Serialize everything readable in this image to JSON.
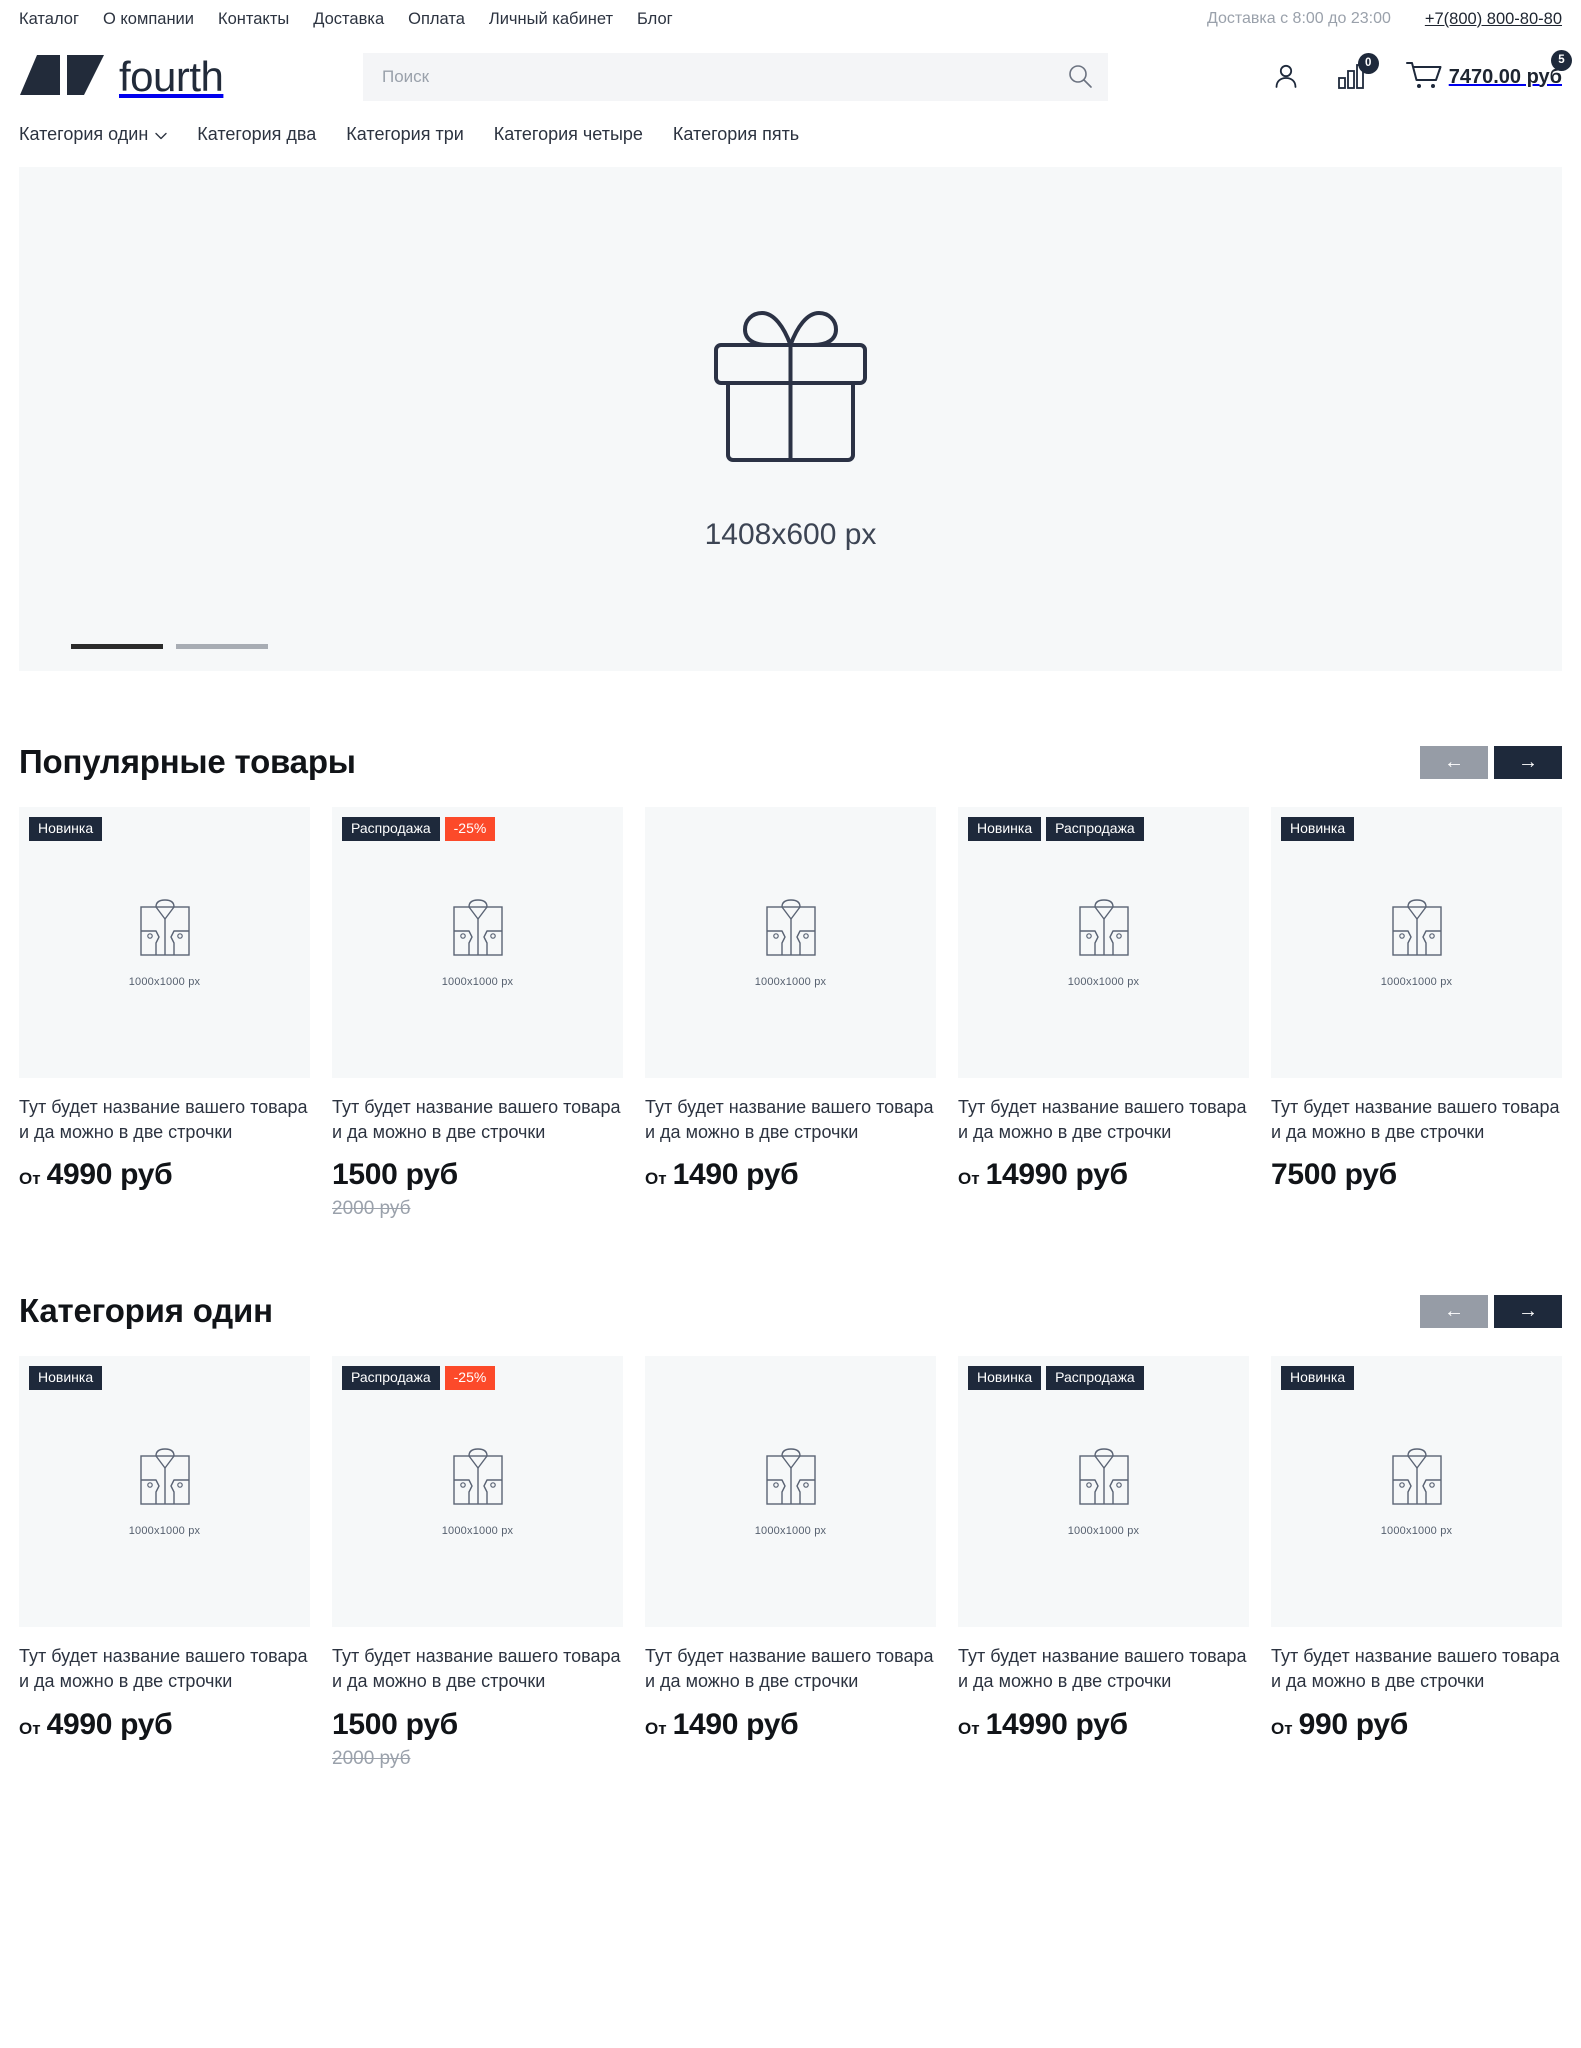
{
  "topbar": {
    "nav": [
      {
        "label": "Каталог"
      },
      {
        "label": "О компании"
      },
      {
        "label": "Контакты"
      },
      {
        "label": "Доставка"
      },
      {
        "label": "Оплата"
      },
      {
        "label": "Личный кабинет"
      },
      {
        "label": "Блог"
      }
    ],
    "delivery_hours": "Доставка с 8:00 до 23:00",
    "phone": "+7(800) 800-80-80"
  },
  "header": {
    "logo_text": "fourth",
    "search": {
      "placeholder": "Поиск",
      "value": ""
    },
    "compare_count": "0",
    "cart_count": "5",
    "cart_total": "7470.00 руб"
  },
  "catnav": [
    {
      "label": "Категория один",
      "has_chevron": true
    },
    {
      "label": "Категория два",
      "has_chevron": false
    },
    {
      "label": "Категория три",
      "has_chevron": false
    },
    {
      "label": "Категория четыре",
      "has_chevron": false
    },
    {
      "label": "Категория пять",
      "has_chevron": false
    }
  ],
  "hero": {
    "size_label": "1408x600 px",
    "slides": [
      {
        "active": true
      },
      {
        "active": false
      }
    ]
  },
  "sections": [
    {
      "title": "Популярные товары",
      "prev_label": "←",
      "next_label": "→",
      "products": [
        {
          "badges": [
            {
              "text": "Новинка",
              "kind": "new"
            }
          ],
          "media_size": "1000x1000 px",
          "title": "Тут будет название вашего товара и да можно в две строчки",
          "price_from": "От",
          "price": "4990 руб",
          "old_price": ""
        },
        {
          "badges": [
            {
              "text": "Распродажа",
              "kind": "sale"
            },
            {
              "text": "-25%",
              "kind": "discount"
            }
          ],
          "media_size": "1000x1000 px",
          "title": "Тут будет название вашего товара и да можно в две строчки",
          "price_from": "",
          "price": "1500 руб",
          "old_price": "2000 руб"
        },
        {
          "badges": [],
          "media_size": "1000x1000 px",
          "title": "Тут будет название вашего товара и да можно в две строчки",
          "price_from": "От",
          "price": "1490 руб",
          "old_price": ""
        },
        {
          "badges": [
            {
              "text": "Новинка",
              "kind": "new"
            },
            {
              "text": "Распродажа",
              "kind": "sale"
            }
          ],
          "media_size": "1000x1000 px",
          "title": "Тут будет название вашего товара и да можно в две строчки",
          "price_from": "От",
          "price": "14990 руб",
          "old_price": ""
        },
        {
          "badges": [
            {
              "text": "Новинка",
              "kind": "new"
            }
          ],
          "media_size": "1000x1000 px",
          "title": "Тут будет название вашего товара и да можно в две строчки",
          "price_from": "",
          "price": "7500 руб",
          "old_price": ""
        }
      ]
    },
    {
      "title": "Категория один",
      "prev_label": "←",
      "next_label": "→",
      "products": [
        {
          "badges": [
            {
              "text": "Новинка",
              "kind": "new"
            }
          ],
          "media_size": "1000x1000 px",
          "title": "Тут будет название вашего товара и да можно в две строчки",
          "price_from": "От",
          "price": "4990 руб",
          "old_price": ""
        },
        {
          "badges": [
            {
              "text": "Распродажа",
              "kind": "sale"
            },
            {
              "text": "-25%",
              "kind": "discount"
            }
          ],
          "media_size": "1000x1000 px",
          "title": "Тут будет название вашего товара и да можно в две строчки",
          "price_from": "",
          "price": "1500 руб",
          "old_price": "2000 руб"
        },
        {
          "badges": [],
          "media_size": "1000x1000 px",
          "title": "Тут будет название вашего товара и да можно в две строчки",
          "price_from": "От",
          "price": "1490 руб",
          "old_price": ""
        },
        {
          "badges": [
            {
              "text": "Новинка",
              "kind": "new"
            },
            {
              "text": "Распродажа",
              "kind": "sale"
            }
          ],
          "media_size": "1000x1000 px",
          "title": "Тут будет название вашего товара и да можно в две строчки",
          "price_from": "От",
          "price": "14990 руб",
          "old_price": ""
        },
        {
          "badges": [
            {
              "text": "Новинка",
              "kind": "new"
            }
          ],
          "media_size": "1000x1000 px",
          "title": "Тут будет название вашего товара и да можно в две строчки",
          "price_from": "От",
          "price": "990 руб",
          "old_price": ""
        }
      ]
    }
  ],
  "colors": {
    "brand_dark": "#1e293b",
    "discount": "#fc4a2a",
    "muted": "#9aa1ab",
    "placeholder_bg": "#f6f8f9"
  }
}
